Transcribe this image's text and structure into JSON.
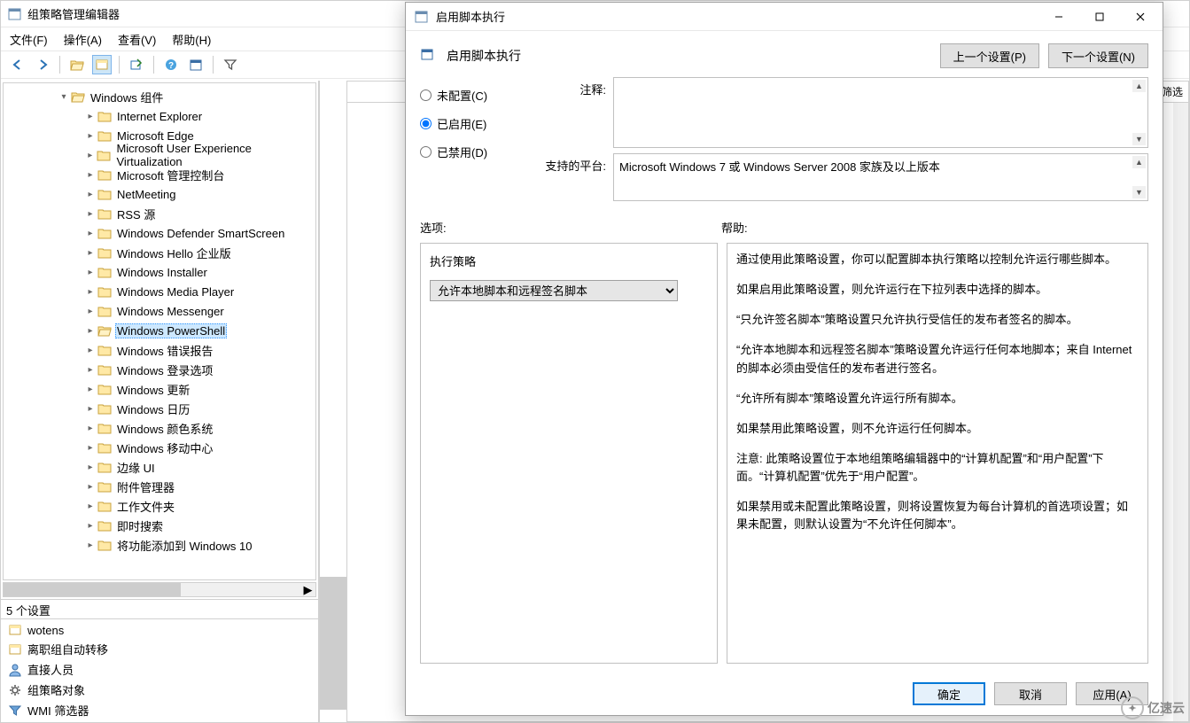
{
  "editor": {
    "title": "组策略管理编辑器",
    "menu": {
      "file": "文件(F)",
      "action": "操作(A)",
      "view": "查看(V)",
      "help": "帮助(H)"
    },
    "content_header": "筛选",
    "status": "5 个设置",
    "tree": {
      "root": "Windows 组件",
      "items": [
        "Internet Explorer",
        "Microsoft Edge",
        "Microsoft User Experience Virtualization",
        "Microsoft 管理控制台",
        "NetMeeting",
        "RSS 源",
        "Windows Defender SmartScreen",
        "Windows Hello 企业版",
        "Windows Installer",
        "Windows Media Player",
        "Windows Messenger",
        "Windows PowerShell",
        "Windows 错误报告",
        "Windows 登录选项",
        "Windows 更新",
        "Windows 日历",
        "Windows 颜色系统",
        "Windows 移动中心",
        "边缘 UI",
        "附件管理器",
        "工作文件夹",
        "即时搜索",
        "将功能添加到 Windows 10"
      ],
      "selected_index": 11
    },
    "below": {
      "i0": "wotens",
      "i1": "离职组自动转移",
      "i2": "直接人员",
      "i3": "组策略对象",
      "i4": "WMI 筛选器"
    }
  },
  "dialog": {
    "title": "启用脚本执行",
    "heading": "启用脚本执行",
    "prev": "上一个设置(P)",
    "next": "下一个设置(N)",
    "radios": {
      "n": "未配置(C)",
      "e": "已启用(E)",
      "d": "已禁用(D)"
    },
    "notes_label": "注释:",
    "platform_label": "支持的平台:",
    "platform": "Microsoft Windows 7 或 Windows Server 2008 家族及以上版本",
    "options_label": "选项:",
    "help_label": "帮助:",
    "exec_policy_label": "执行策略",
    "exec_policy_value": "允许本地脚本和远程签名脚本",
    "help": {
      "p1": "通过使用此策略设置，你可以配置脚本执行策略以控制允许运行哪些脚本。",
      "p2": "如果启用此策略设置，则允许运行在下拉列表中选择的脚本。",
      "p3": "“只允许签名脚本”策略设置只允许执行受信任的发布者签名的脚本。",
      "p4": "“允许本地脚本和远程签名脚本”策略设置允许运行任何本地脚本；来自 Internet 的脚本必须由受信任的发布者进行签名。",
      "p5": "“允许所有脚本”策略设置允许运行所有脚本。",
      "p6": "如果禁用此策略设置，则不允许运行任何脚本。",
      "p7": "注意: 此策略设置位于本地组策略编辑器中的“计算机配置”和“用户配置”下面。“计算机配置”优先于“用户配置”。",
      "p8": "如果禁用或未配置此策略设置，则将设置恢复为每台计算机的首选项设置；如果未配置，则默认设置为“不允许任何脚本”。"
    },
    "ok": "确定",
    "cancel": "取消",
    "apply": "应用(A)"
  },
  "watermark": "亿速云"
}
